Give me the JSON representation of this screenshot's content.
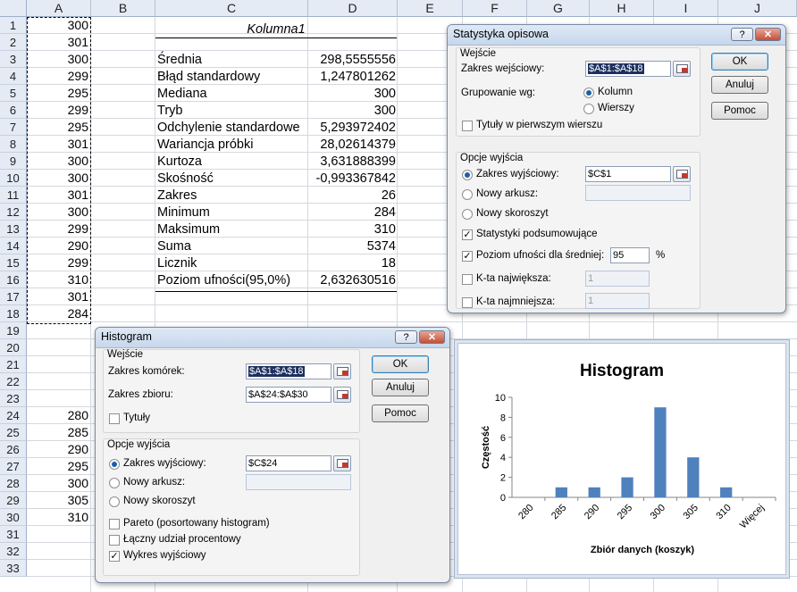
{
  "columns": [
    "A",
    "B",
    "C",
    "D",
    "E",
    "F",
    "G",
    "H",
    "I",
    "J"
  ],
  "rows": [
    "1",
    "2",
    "3",
    "4",
    "5",
    "6",
    "7",
    "8",
    "9",
    "10",
    "11",
    "12",
    "13",
    "14",
    "15",
    "16",
    "17",
    "18",
    "19",
    "20",
    "21",
    "22",
    "23",
    "24",
    "25",
    "26",
    "27",
    "28",
    "29",
    "30",
    "31",
    "32",
    "33"
  ],
  "col_a_data": [
    "300",
    "301",
    "300",
    "299",
    "295",
    "299",
    "295",
    "301",
    "300",
    "300",
    "301",
    "300",
    "299",
    "290",
    "299",
    "310",
    "301",
    "284"
  ],
  "bins": [
    "280",
    "285",
    "290",
    "295",
    "300",
    "305",
    "310"
  ],
  "stats": {
    "header": "Kolumna1",
    "labels": [
      "Średnia",
      "Błąd standardowy",
      "Mediana",
      "Tryb",
      "Odchylenie standardowe",
      "Wariancja próbki",
      "Kurtoza",
      "Skośność",
      "Zakres",
      "Minimum",
      "Maksimum",
      "Suma",
      "Licznik",
      "Poziom ufności(95,0%)"
    ],
    "values": [
      "298,5555556",
      "1,247801262",
      "300",
      "300",
      "5,293972402",
      "28,02614379",
      "3,631888399",
      "-0,993367842",
      "26",
      "284",
      "310",
      "5374",
      "18",
      "2,632630516"
    ]
  },
  "stat_dialog": {
    "title": "Statystyka opisowa",
    "input_group": "Wejście",
    "input_range_label": "Zakres wejściowy:",
    "input_range_value": "$A$1:$A$18",
    "grouping_label": "Grupowanie wg:",
    "grouping_column": "Kolumn",
    "grouping_row": "Wierszy",
    "labels_first_row": "Tytuły w pierwszym wierszu",
    "output_group": "Opcje wyjścia",
    "output_range_label": "Zakres wyjściowy:",
    "output_range_value": "$C$1",
    "new_sheet": "Nowy arkusz:",
    "new_workbook": "Nowy skoroszyt",
    "summary": "Statystyki podsumowujące",
    "confidence": "Poziom ufności dla średniej:",
    "confidence_value": "95",
    "percent": "%",
    "kth_largest": "K-ta największa:",
    "kth_largest_value": "1",
    "kth_smallest": "K-ta najmniejsza:",
    "kth_smallest_value": "1",
    "ok": "OK",
    "cancel": "Anuluj",
    "help": "Pomoc",
    "help_icon": "?",
    "close_icon": "✕"
  },
  "hist_dialog": {
    "title": "Histogram",
    "input_group": "Wejście",
    "input_range_label": "Zakres komórek:",
    "input_range_value": "$A$1:$A$18",
    "bin_range_label": "Zakres zbioru:",
    "bin_range_value": "$A$24:$A$30",
    "labels": "Tytuły",
    "output_group": "Opcje wyjścia",
    "output_range_label": "Zakres wyjściowy:",
    "output_range_value": "$C$24",
    "new_sheet": "Nowy arkusz:",
    "new_workbook": "Nowy skoroszyt",
    "pareto": "Pareto (posortowany histogram)",
    "cumulative": "Łączny udział procentowy",
    "chart_output": "Wykres wyjściowy",
    "ok": "OK",
    "cancel": "Anuluj",
    "help": "Pomoc",
    "help_icon": "?",
    "close_icon": "✕"
  },
  "chart_data": {
    "type": "bar",
    "title": "Histogram",
    "xlabel": "Zbiór danych  (koszyk)",
    "ylabel": "Częstość",
    "categories": [
      "280",
      "285",
      "290",
      "295",
      "300",
      "305",
      "310",
      "Więcej"
    ],
    "values": [
      0,
      1,
      1,
      2,
      9,
      4,
      1,
      0
    ],
    "ylim": [
      0,
      10
    ],
    "yticks": [
      "0",
      "2",
      "4",
      "6",
      "8",
      "10"
    ],
    "bar_color": "#4f81bd",
    "grid": false
  }
}
